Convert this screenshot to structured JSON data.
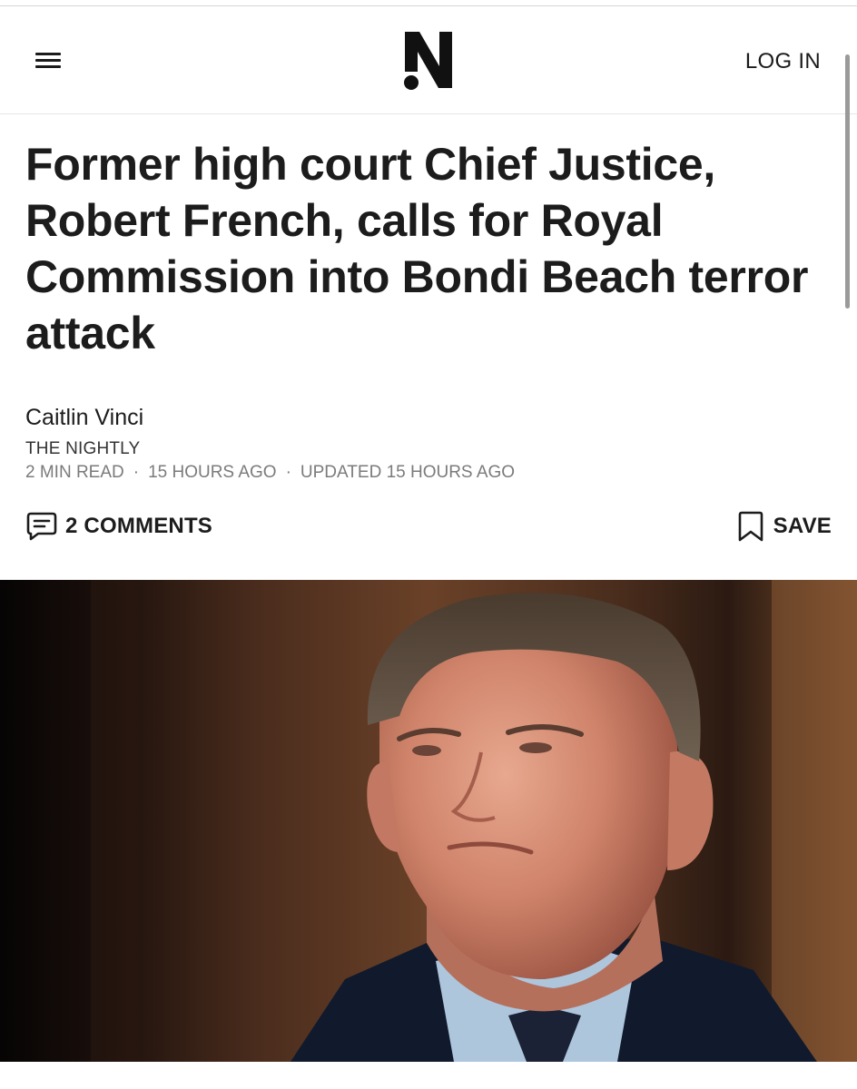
{
  "header": {
    "logo_text": "N",
    "login_label": "LOG IN"
  },
  "article": {
    "headline": "Former high court Chief Justice, Robert French, calls for Royal Commission into Bondi Beach terror attack",
    "author": "Caitlin Vinci",
    "publication": "THE NIGHTLY",
    "read_time": "2 MIN READ",
    "published": "15 HOURS AGO",
    "updated": "UPDATED 15 HOURS AGO",
    "separator": "·"
  },
  "actions": {
    "comments_label": "2 COMMENTS",
    "save_label": "SAVE"
  },
  "icons": {
    "menu": "hamburger-menu-icon",
    "comments": "speech-bubble-icon",
    "save": "bookmark-icon"
  },
  "colors": {
    "text": "#1c1c1c",
    "meta": "#7b7b7b",
    "background": "#ffffff"
  }
}
